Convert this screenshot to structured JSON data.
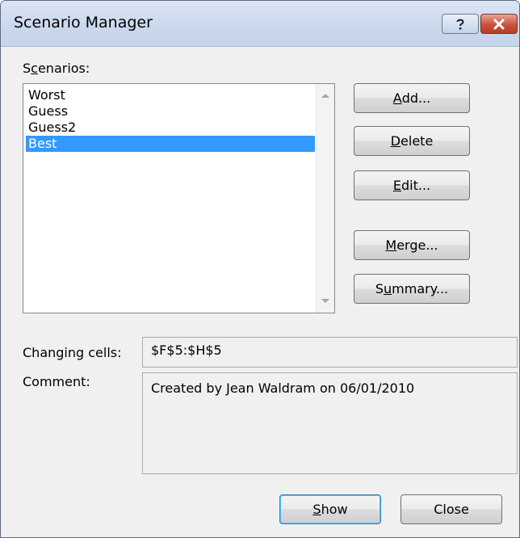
{
  "window": {
    "title": "Scenario Manager",
    "help_glyph": "?",
    "close_glyph": "x"
  },
  "scenarios": {
    "label_pre": "S",
    "label_key": "c",
    "label_post": "enarios:",
    "items": [
      {
        "label": "Worst",
        "selected": false
      },
      {
        "label": "Guess",
        "selected": false
      },
      {
        "label": "Guess2",
        "selected": false
      },
      {
        "label": "Best",
        "selected": true
      }
    ]
  },
  "buttons": {
    "add": {
      "key": "A",
      "rest": "dd..."
    },
    "delete": {
      "key": "D",
      "rest": "elete"
    },
    "edit": {
      "key": "E",
      "rest": "dit..."
    },
    "merge": {
      "key": "M",
      "rest": "erge..."
    },
    "summary": {
      "pre": "S",
      "key": "u",
      "rest": "mmary..."
    },
    "show": {
      "key": "S",
      "rest": "how"
    },
    "close": {
      "label": "Close"
    }
  },
  "details": {
    "changing_cells_label": "Changing cells:",
    "changing_cells_value": "$F$5:$H$5",
    "comment_label": "Comment:",
    "comment_value": "Created by Jean Waldram on 06/01/2010"
  },
  "colors": {
    "selection": "#3399ff",
    "close_button": "#c9523d"
  }
}
